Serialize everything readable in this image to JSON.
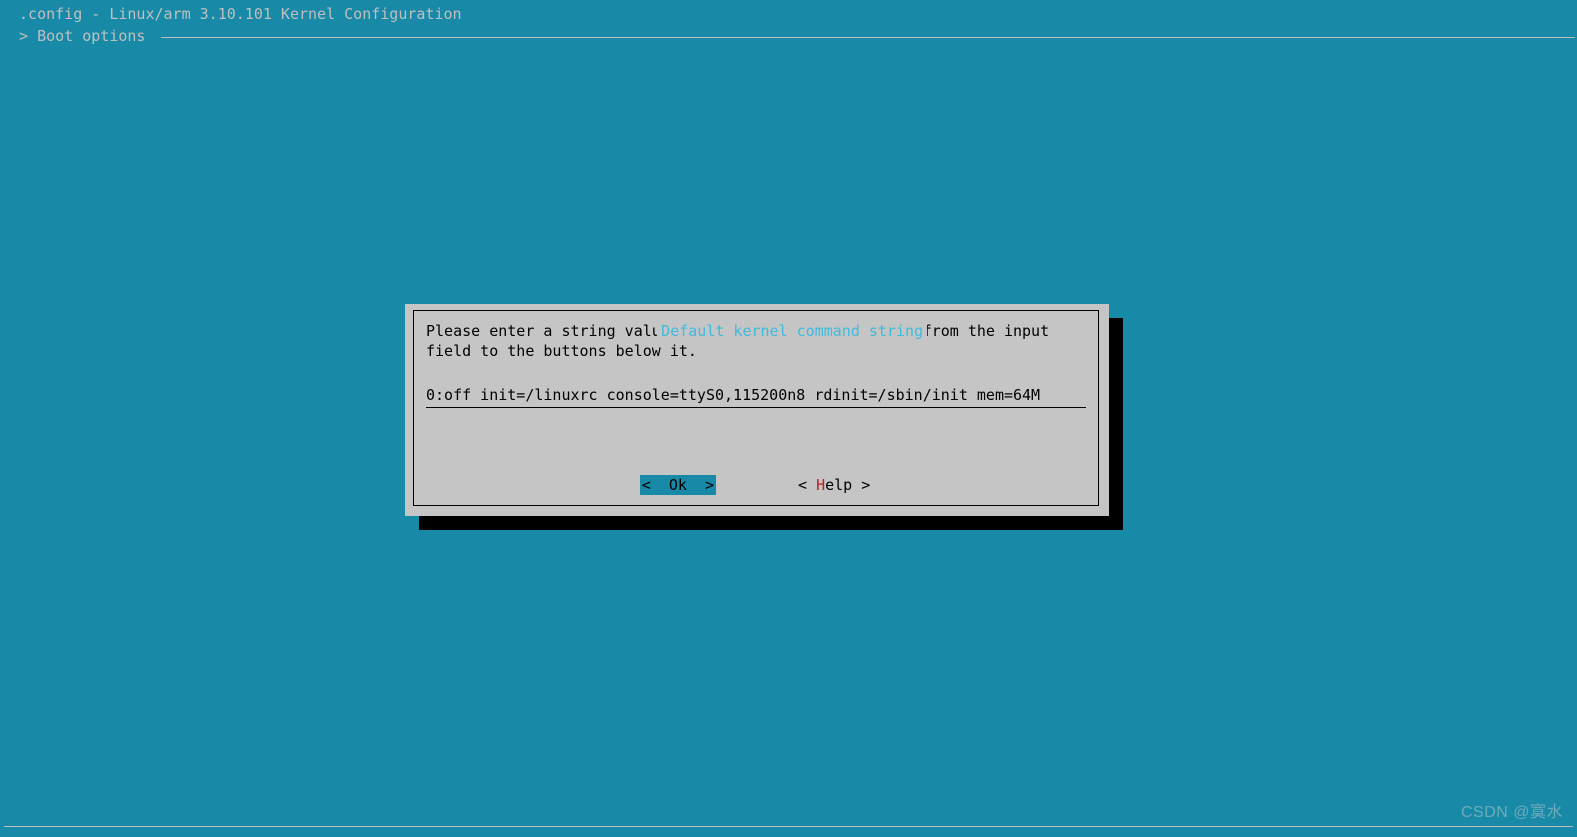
{
  "header": {
    "title": " .config - Linux/arm 3.10.101 Kernel Configuration",
    "breadcrumb": " > Boot options "
  },
  "dialog": {
    "title": "Default kernel command string",
    "body": "Please enter a string value. Use the <TAB> key to move from the input\nfield to the buttons below it.",
    "input_value": "0:off init=/linuxrc console=ttyS0,115200n8 rdinit=/sbin/init mem=64M",
    "buttons": {
      "ok_open": "<  ",
      "ok_hot": "O",
      "ok_rest": "k  >",
      "help_open": "< ",
      "help_hot": "H",
      "help_rest": "elp >"
    }
  },
  "watermark": "CSDN @寞水"
}
